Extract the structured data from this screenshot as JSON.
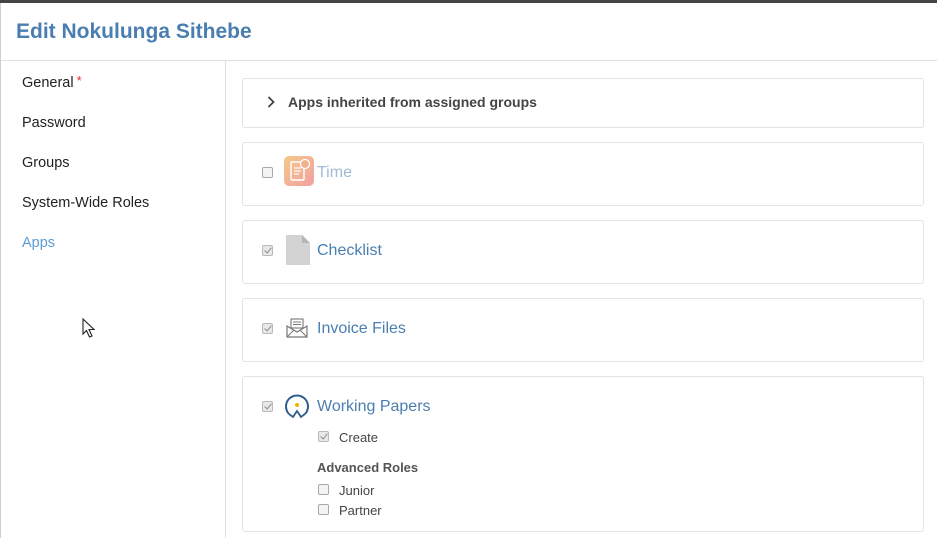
{
  "header": {
    "title": "Edit Nokulunga Sithebe"
  },
  "sidebar": {
    "items": [
      {
        "label": "General",
        "required_mark": "*"
      },
      {
        "label": "Password"
      },
      {
        "label": "Groups"
      },
      {
        "label": "System-Wide Roles"
      },
      {
        "label": "Apps",
        "active": true
      }
    ]
  },
  "apps": {
    "inherited_label": "Apps inherited from assigned groups",
    "list": [
      {
        "name": "Time",
        "checked": false,
        "disabled": true,
        "icon": "time-app-icon"
      },
      {
        "name": "Checklist",
        "checked": true,
        "icon": "document-icon"
      },
      {
        "name": "Invoice Files",
        "checked": true,
        "icon": "envelope-icon"
      },
      {
        "name": "Working Papers",
        "checked": true,
        "icon": "working-papers-logo-icon"
      }
    ],
    "working_papers": {
      "create_label": "Create",
      "create_checked": true,
      "advanced_roles_heading": "Advanced Roles",
      "roles": [
        {
          "label": "Junior",
          "checked": false
        },
        {
          "label": "Partner",
          "checked": false
        }
      ]
    }
  },
  "colors": {
    "accent": "#4a7eb0",
    "active_nav": "#5b9bd5",
    "required": "#d9302c"
  }
}
